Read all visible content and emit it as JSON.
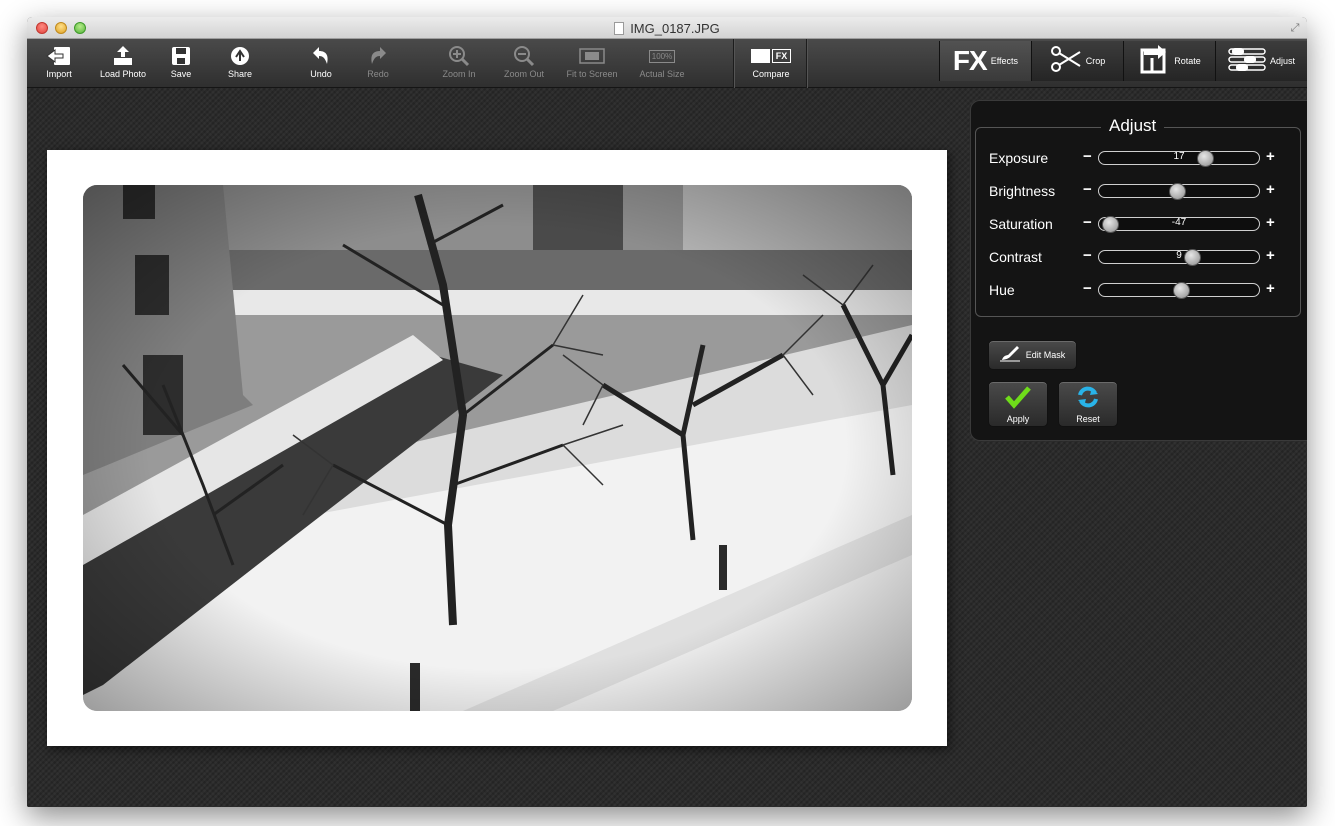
{
  "window": {
    "title": "IMG_0187.JPG"
  },
  "toolbar": {
    "import": "Import",
    "load_photo": "Load Photo",
    "save": "Save",
    "share": "Share",
    "undo": "Undo",
    "redo": "Redo",
    "zoom_in": "Zoom In",
    "zoom_out": "Zoom Out",
    "fit_to_screen": "Fit to Screen",
    "actual_size": "Actual Size",
    "actual_size_icon_text": "100%",
    "compare": "Compare",
    "compare_icon_text": "FX"
  },
  "modes": {
    "effects_icon_text": "FX",
    "effects": "Effects",
    "crop": "Crop",
    "rotate": "Rotate",
    "adjust": "Adjust"
  },
  "adjust": {
    "title": "Adjust",
    "sliders": [
      {
        "label": "Exposure",
        "value": "17",
        "level": 0.66
      },
      {
        "label": "Brightness",
        "value": "-1",
        "level": 0.49
      },
      {
        "label": "Saturation",
        "value": "-47",
        "level": 0.07
      },
      {
        "label": "Contrast",
        "value": "9",
        "level": 0.58
      },
      {
        "label": "Hue",
        "value": "4",
        "level": 0.51
      }
    ],
    "minus_symbol": "−",
    "plus_symbol": "+",
    "edit_mask": "Edit Mask",
    "apply": "Apply",
    "reset": "Reset"
  },
  "colors": {
    "apply_check": "#6fdc1a",
    "reset_icon": "#29b3e8"
  }
}
